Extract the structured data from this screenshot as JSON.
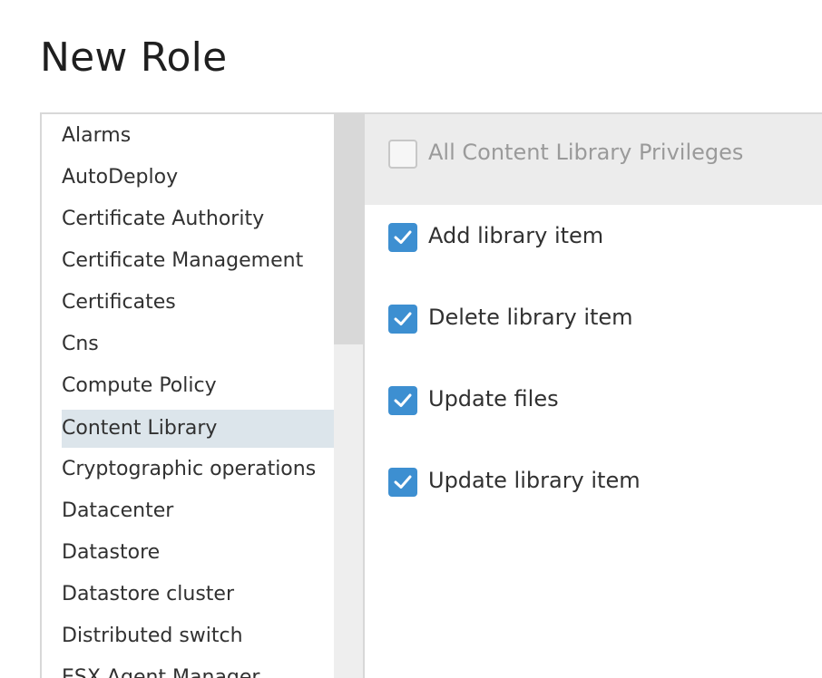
{
  "page": {
    "title": "New Role"
  },
  "categories": [
    {
      "label": "Alarms"
    },
    {
      "label": "AutoDeploy"
    },
    {
      "label": "Certificate Authority"
    },
    {
      "label": "Certificate Management"
    },
    {
      "label": "Certificates"
    },
    {
      "label": "Cns"
    },
    {
      "label": "Compute Policy"
    },
    {
      "label": "Content Library",
      "selected": true
    },
    {
      "label": "Cryptographic operations"
    },
    {
      "label": "Datacenter"
    },
    {
      "label": "Datastore"
    },
    {
      "label": "Datastore cluster"
    },
    {
      "label": "Distributed switch"
    },
    {
      "label": "ESX Agent Manager"
    }
  ],
  "privileges": {
    "all": {
      "label": "All Content Library Privileges",
      "checked": false
    },
    "items": [
      {
        "label": "Add library item",
        "checked": true
      },
      {
        "label": "Delete library item",
        "checked": true
      },
      {
        "label": "Update files",
        "checked": true
      },
      {
        "label": "Update library item",
        "checked": true
      }
    ]
  },
  "colors": {
    "accent": "#3d8fd1",
    "selected_row": "#dce5eb",
    "header_bg": "#ececec"
  }
}
